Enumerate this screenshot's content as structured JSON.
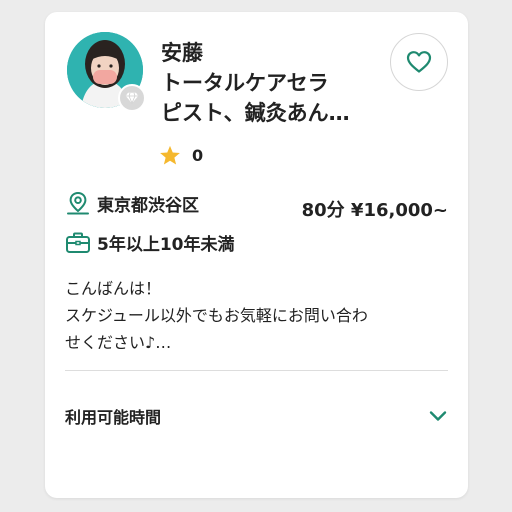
{
  "therapist": {
    "name": "安藤",
    "title_line1": "トータルケアセラ",
    "title_line2": "ピスト、鍼灸あん…",
    "rating_count": "0",
    "location": "東京都渋谷区",
    "price": "80分 ¥16,000~",
    "experience": "5年以上10年未満",
    "message_line1": "こんばんは！",
    "message_line2": "スケジュール以外でもお気軽にお問い合わ",
    "message_line3": "せください♪…"
  },
  "availability": {
    "label": "利用可能時間"
  },
  "colors": {
    "accent": "#1f8a70",
    "star": "#f5b82e",
    "avatar_bg": "#2fb3b0"
  },
  "icons": [
    "diamond-badge-icon",
    "heart-icon",
    "star-icon",
    "location-pin-icon",
    "briefcase-icon",
    "chevron-down-icon"
  ]
}
